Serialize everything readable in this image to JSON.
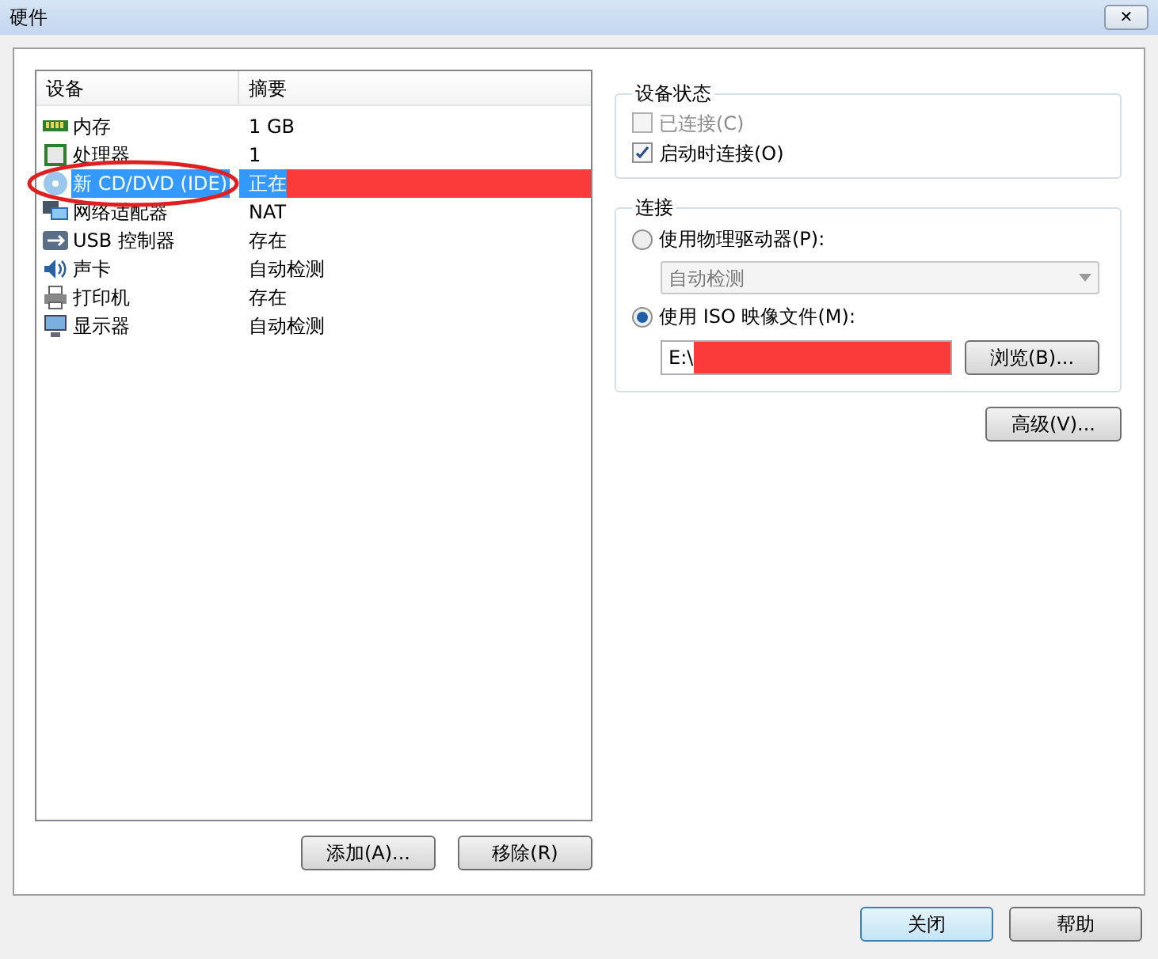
{
  "window": {
    "title": "硬件",
    "close": "✕"
  },
  "devices": {
    "columns": [
      "设备",
      "摘要"
    ],
    "rows": [
      {
        "kind": "memory",
        "name": "内存",
        "summary": "1 GB",
        "selected": false
      },
      {
        "kind": "cpu",
        "name": "处理器",
        "summary": "1",
        "selected": false
      },
      {
        "kind": "cd",
        "name": "新 CD/DVD (IDE)",
        "summary": "正在",
        "selected": true,
        "redacted": true,
        "annotated": true
      },
      {
        "kind": "network",
        "name": "网络适配器",
        "summary": "NAT",
        "selected": false
      },
      {
        "kind": "usb",
        "name": "USB 控制器",
        "summary": "存在",
        "selected": false
      },
      {
        "kind": "sound",
        "name": "声卡",
        "summary": "自动检测",
        "selected": false
      },
      {
        "kind": "printer",
        "name": "打印机",
        "summary": "存在",
        "selected": false
      },
      {
        "kind": "display",
        "name": "显示器",
        "summary": "自动检测",
        "selected": false
      }
    ]
  },
  "list_buttons": [
    "添加(A)...",
    "移除(R)"
  ],
  "device_status": {
    "title": "设备状态",
    "options": [
      {
        "label": "已连接(C)",
        "checked": false,
        "disabled": true
      },
      {
        "label": "启动时连接(O)",
        "checked": true,
        "disabled": false
      }
    ]
  },
  "connection": {
    "title": "连接",
    "physical": {
      "label": "使用物理驱动器(P):",
      "selected": false,
      "drive": "自动检测"
    },
    "iso": {
      "label": "使用 ISO 映像文件(M):",
      "selected": true,
      "value": "E:\\",
      "redacted": true,
      "browse": "浏览(B)..."
    }
  },
  "advanced": "高级(V)...",
  "footer_buttons": [
    {
      "label": "关闭",
      "selected": true
    },
    {
      "label": "帮助",
      "selected": false
    }
  ]
}
